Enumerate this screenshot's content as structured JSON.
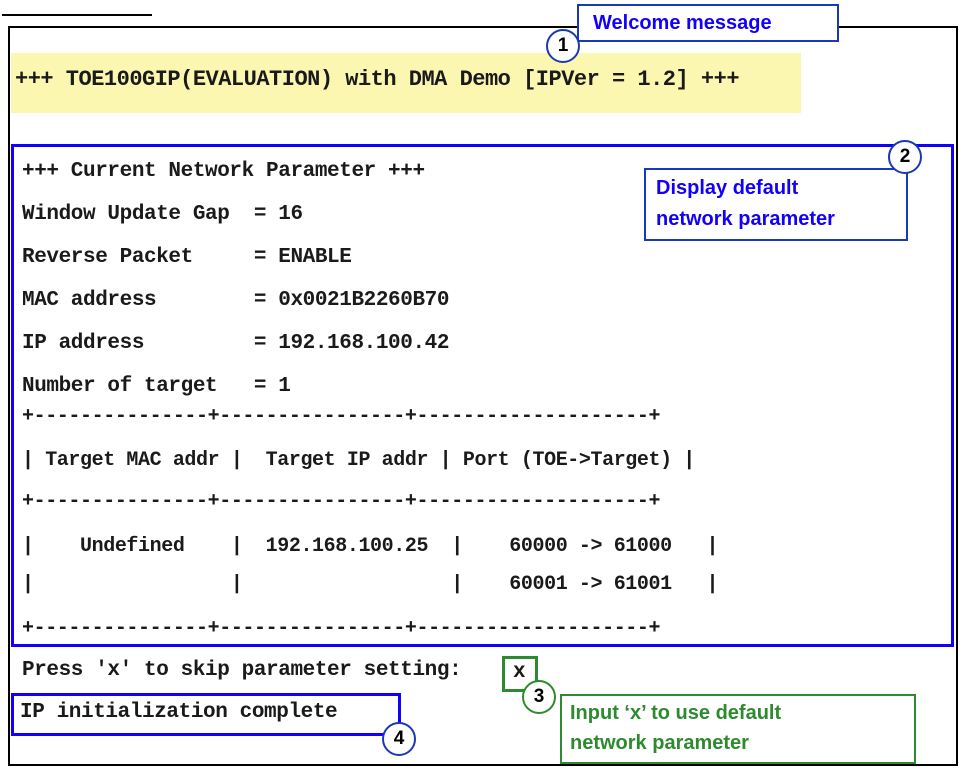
{
  "welcome": {
    "text": "+++ TOE100GIP(EVALUATION) with DMA Demo [IPVer = 1.2] +++",
    "callout_number": "1",
    "callout_label": "Welcome message"
  },
  "network": {
    "lines": [
      "+++ Current Network Parameter +++",
      "Window Update Gap  = 16",
      "Reverse Packet     = ENABLE",
      "MAC address        = 0x0021B2260B70",
      "IP address         = 192.168.100.42",
      "Number of target   = 1"
    ],
    "table_lines": [
      "+---------------+----------------+--------------------+",
      "| Target MAC addr |  Target IP addr | Port (TOE->Target) |",
      "+---------------+----------------+--------------------+",
      "|    Undefined    |  192.168.100.25  |    60000 -> 61000   |",
      "|                 |                  |    60001 -> 61001   |",
      "+---------------+----------------+--------------------+"
    ],
    "callout_number": "2",
    "callout_label_1": "Display default",
    "callout_label_2": "network parameter"
  },
  "prompt": {
    "text": "Press 'x' to skip parameter setting:",
    "input_value": "x",
    "callout_number": "3",
    "callout_label_1": "Input ‘x’ to use default",
    "callout_label_2": "network parameter"
  },
  "status": {
    "text": "IP initialization complete",
    "callout_number": "4"
  },
  "colors": {
    "blue_annotation": "#1200ff",
    "green_annotation": "#2e8a2e",
    "welcome_highlight": "#fbf7b0"
  }
}
